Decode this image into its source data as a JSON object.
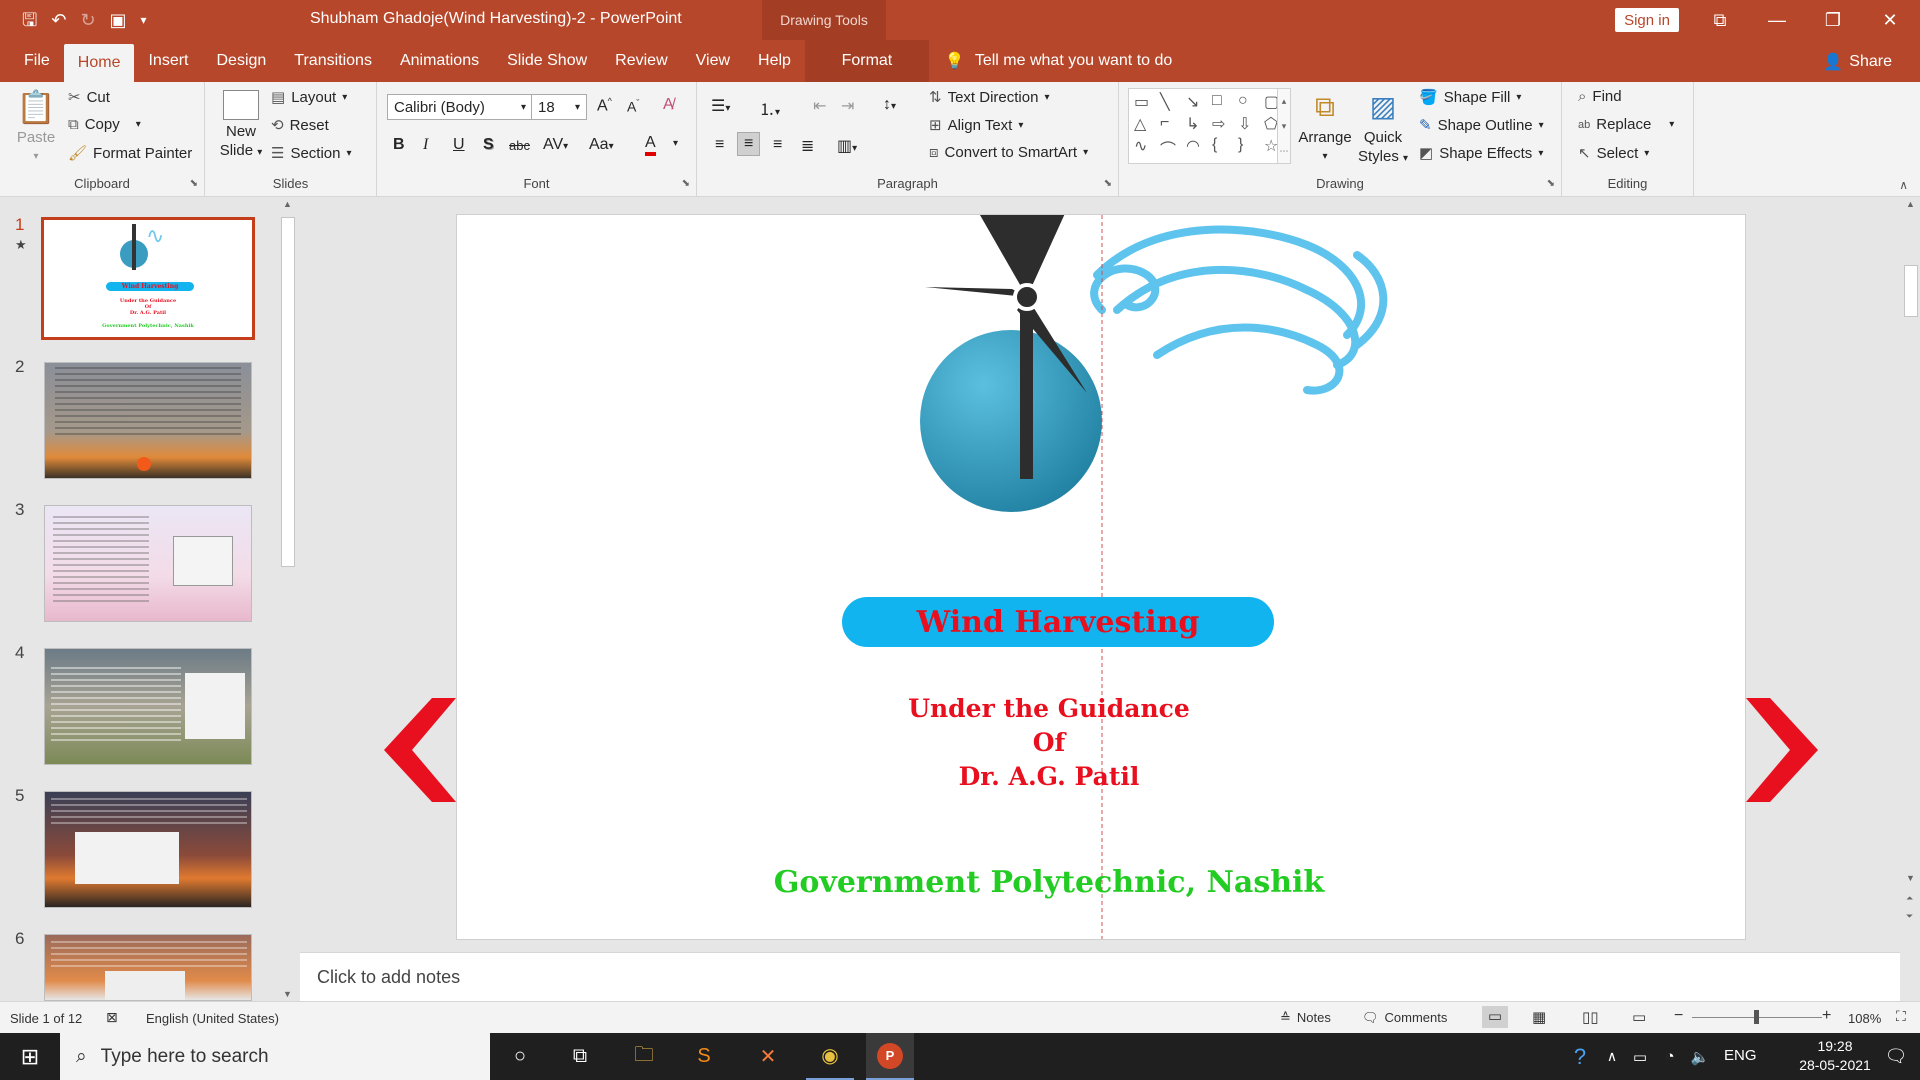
{
  "titlebar": {
    "doc_title": "Shubham Ghadoje(Wind Harvesting)-2  -  PowerPoint",
    "context_tab": "Drawing Tools",
    "sign_in": "Sign in"
  },
  "menu": {
    "tabs": [
      "File",
      "Home",
      "Insert",
      "Design",
      "Transitions",
      "Animations",
      "Slide Show",
      "Review",
      "View",
      "Help",
      "Format"
    ],
    "tell_me": "Tell me what you want to do",
    "share": "Share"
  },
  "ribbon": {
    "clipboard": {
      "label": "Clipboard",
      "paste": "Paste",
      "cut": "Cut",
      "copy": "Copy",
      "format_painter": "Format Painter"
    },
    "slides": {
      "label": "Slides",
      "new_slide_1": "New",
      "new_slide_2": "Slide",
      "layout": "Layout",
      "reset": "Reset",
      "section": "Section"
    },
    "font": {
      "label": "Font",
      "font_name": "Calibri (Body)",
      "font_size": "18"
    },
    "paragraph": {
      "label": "Paragraph",
      "text_direction": "Text Direction",
      "align_text": "Align Text",
      "convert_smartart": "Convert to SmartArt"
    },
    "drawing": {
      "label": "Drawing",
      "arrange": "Arrange",
      "quick_1": "Quick",
      "quick_2": "Styles",
      "shape_fill": "Shape Fill",
      "shape_outline": "Shape Outline",
      "shape_effects": "Shape Effects"
    },
    "editing": {
      "label": "Editing",
      "find": "Find",
      "replace": "Replace",
      "select": "Select"
    }
  },
  "thumbnails": [
    {
      "num": "1",
      "star": "★"
    },
    {
      "num": "2"
    },
    {
      "num": "3"
    },
    {
      "num": "4"
    },
    {
      "num": "5"
    },
    {
      "num": "6"
    }
  ],
  "slide": {
    "title": "Wind Harvesting",
    "guidance_1": "Under the Guidance",
    "guidance_2": "Of",
    "guidance_3": "Dr. A.G. Patil",
    "institute": "Government Polytechnic, Nashik",
    "thumb_title": "Wind Harvesting",
    "thumb_g1": "Under the Guidance",
    "thumb_g2": "Of",
    "thumb_g3": "Dr. A.G. Patil",
    "thumb_inst": "Government Polytechnic, Nashik"
  },
  "notes_placeholder": "Click to add notes",
  "status": {
    "slide_count": "Slide 1 of 12",
    "language": "English (United States)",
    "notes": "Notes",
    "comments": "Comments",
    "zoom": "108%"
  },
  "taskbar": {
    "search_placeholder": "Type here to search",
    "lang": "ENG",
    "time": "19:28",
    "date": "28-05-2021"
  },
  "colors": {
    "accent": "#b7472a",
    "slide_red": "#e8101f",
    "slide_green": "#22cc22",
    "pill_blue": "#12b4ef"
  }
}
